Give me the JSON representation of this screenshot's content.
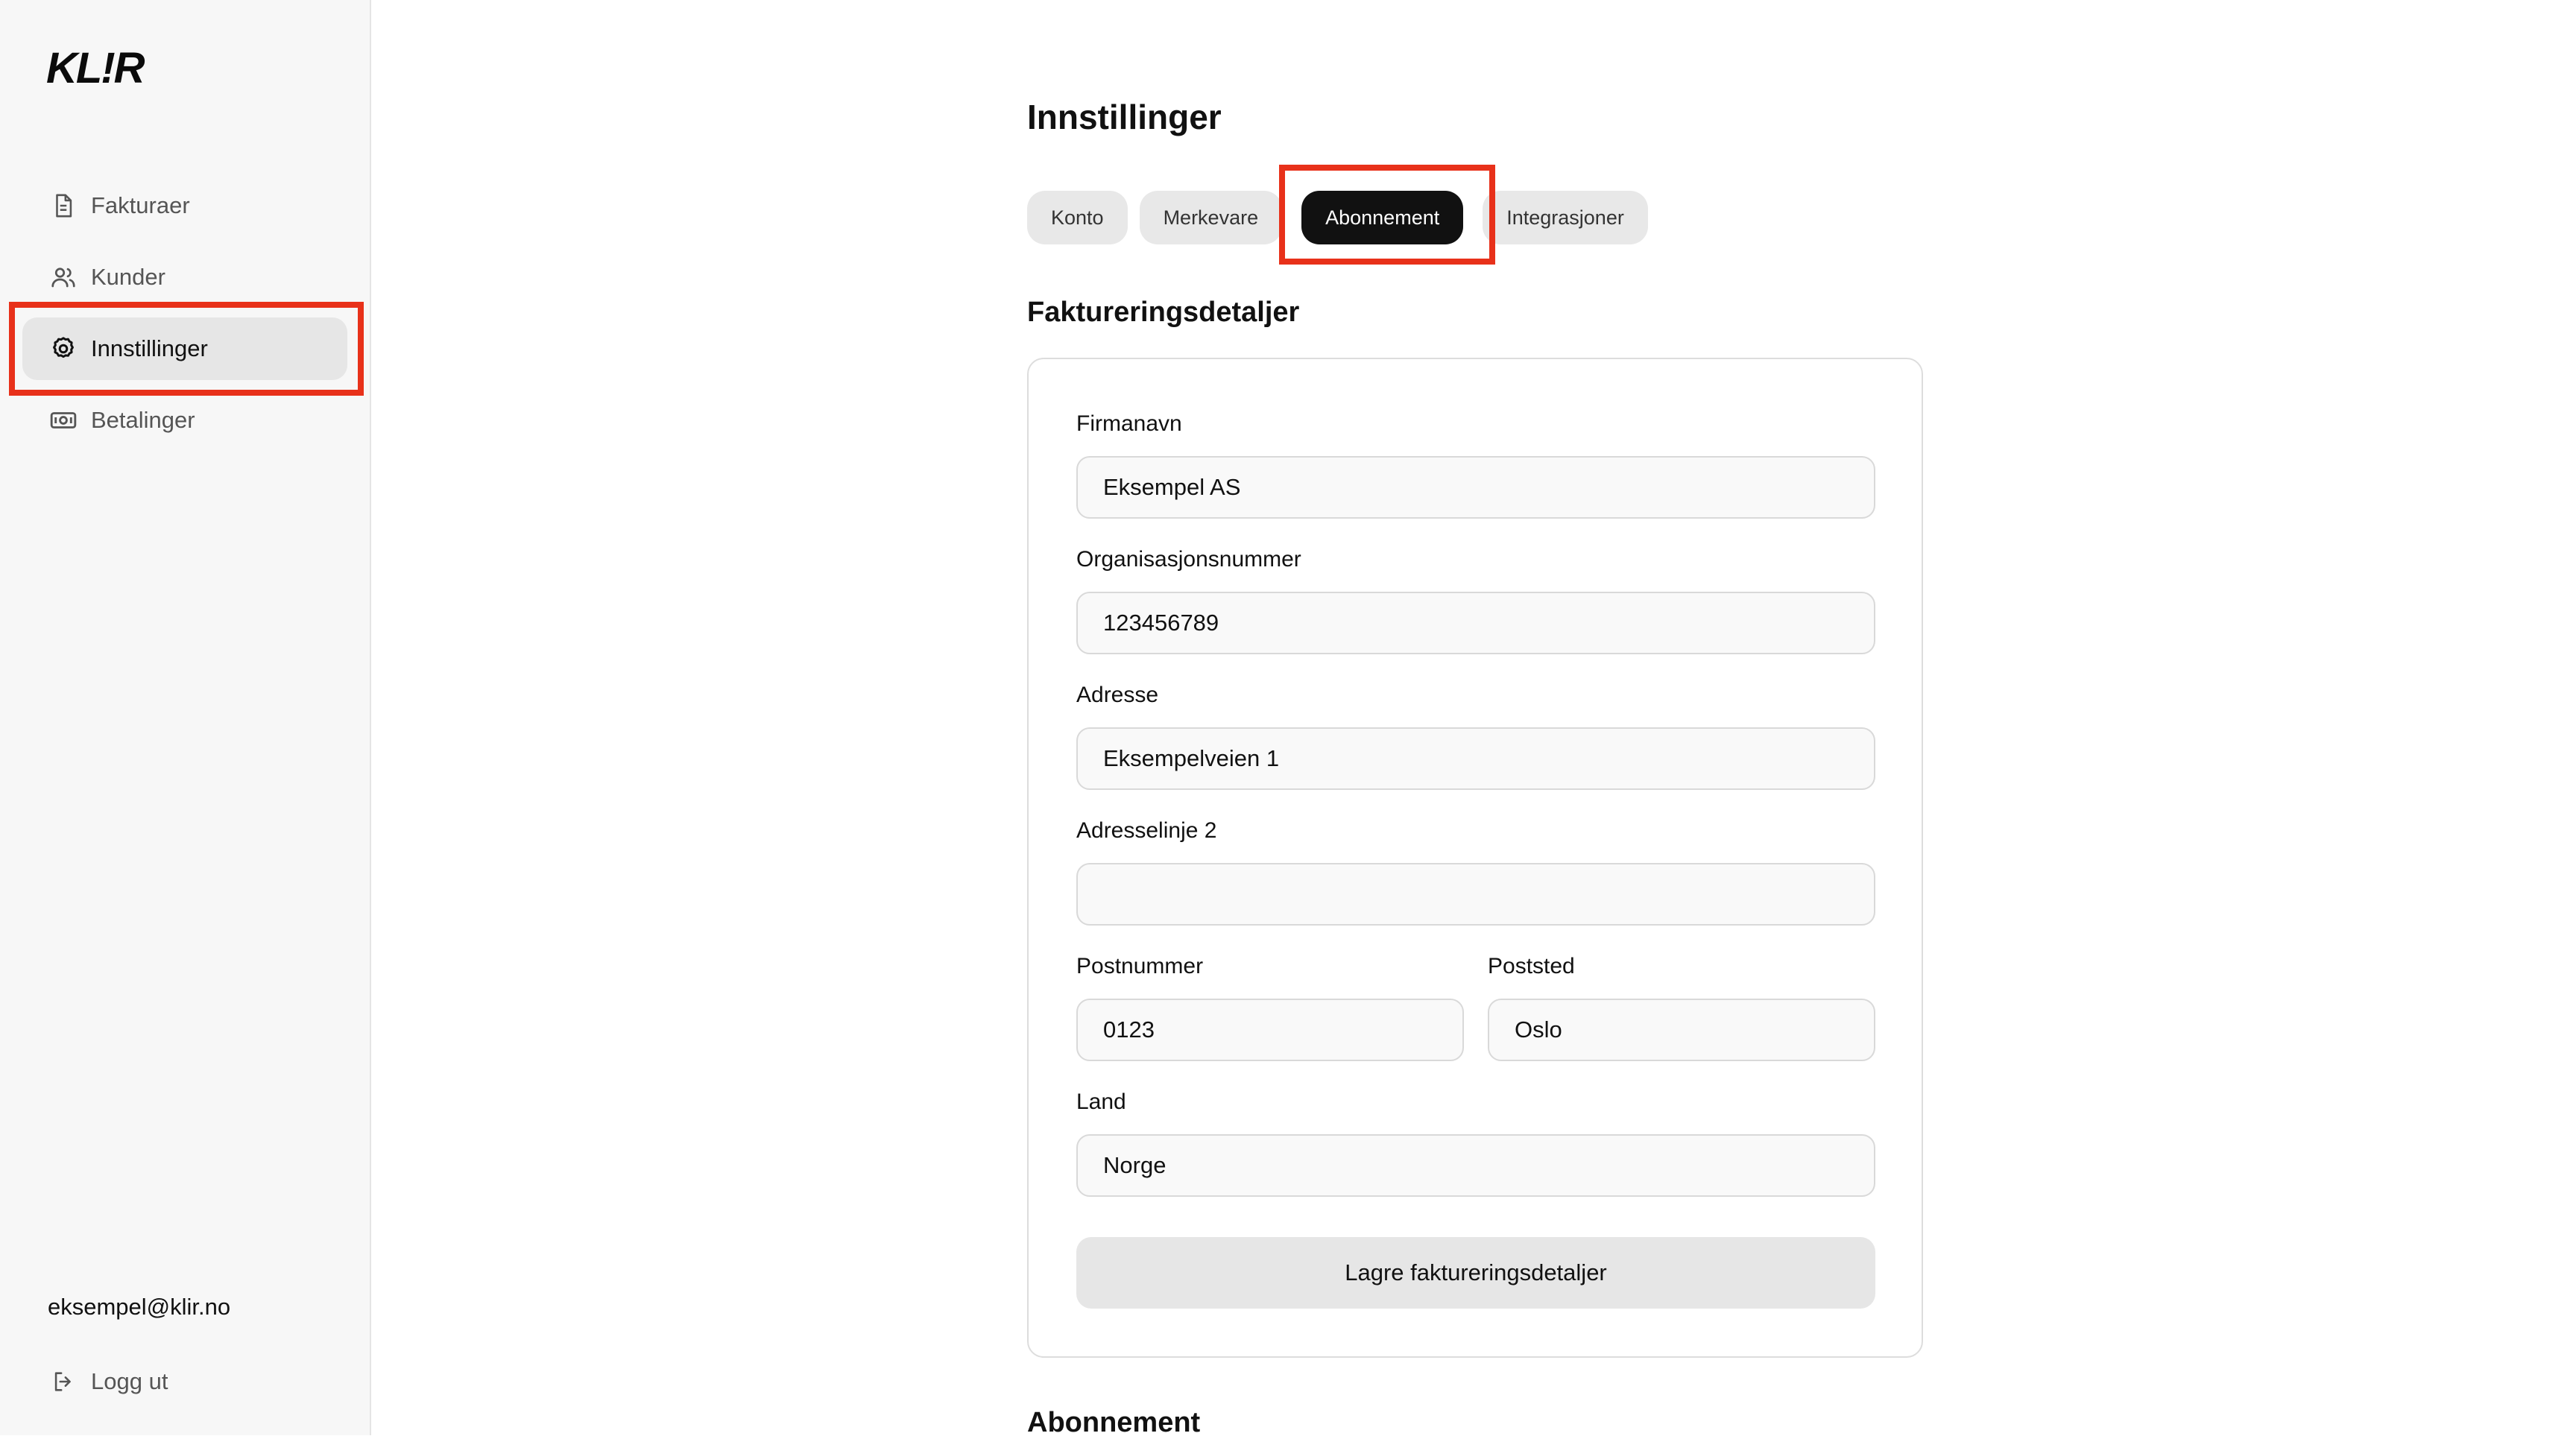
{
  "sidebar": {
    "logo": "KL!R",
    "items": [
      {
        "label": "Fakturaer",
        "icon": "document-icon"
      },
      {
        "label": "Kunder",
        "icon": "users-icon"
      },
      {
        "label": "Innstillinger",
        "icon": "gear-icon",
        "active": true
      },
      {
        "label": "Betalinger",
        "icon": "banknote-icon"
      }
    ],
    "user_email": "eksempel@klir.no",
    "logout_label": "Logg ut",
    "logout_icon": "logout-icon"
  },
  "main": {
    "title": "Innstillinger",
    "tabs": [
      {
        "label": "Konto"
      },
      {
        "label": "Merkevare"
      },
      {
        "label": "Abonnement",
        "active": true
      },
      {
        "label": "Integrasjoner"
      }
    ],
    "billing": {
      "title": "Faktureringsdetaljer",
      "fields": {
        "company_name": {
          "label": "Firmanavn",
          "value": "Eksempel AS"
        },
        "org_number": {
          "label": "Organisasjonsnummer",
          "value": "123456789"
        },
        "address": {
          "label": "Adresse",
          "value": "Eksempelveien 1"
        },
        "address2": {
          "label": "Adresselinje 2",
          "value": ""
        },
        "postal_code": {
          "label": "Postnummer",
          "value": "0123"
        },
        "city": {
          "label": "Poststed",
          "value": "Oslo"
        },
        "country": {
          "label": "Land",
          "value": "Norge"
        }
      },
      "save_label": "Lagre faktureringsdetaljer"
    },
    "subscription_title": "Abonnement"
  },
  "colors": {
    "highlight": "#e8311a",
    "active_tab_bg": "#111111",
    "active_nav_bg": "#e6e6e6",
    "sidebar_bg": "#f7f7f7"
  }
}
